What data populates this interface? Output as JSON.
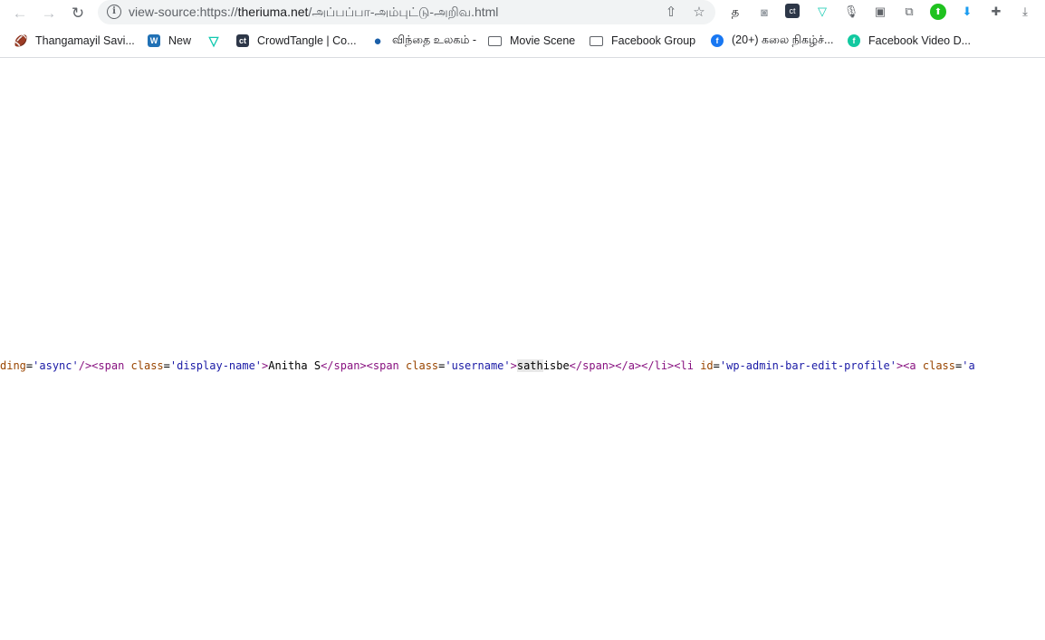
{
  "browser": {
    "url_prefix": "view-source:https://",
    "url_domain": "theriuma.net",
    "url_path": "/அப்பப்பா-அம்புட்டு-அறிவ.html"
  },
  "extensions": [
    {
      "name": "tamil-extension-icon",
      "glyph": "த",
      "color": "#202124"
    },
    {
      "name": "screenshot-extension-icon",
      "glyph": "◙",
      "color": "#9aa0a6"
    },
    {
      "name": "crowdtangle-extension-icon",
      "glyph": "ct",
      "color": "#2d3748"
    },
    {
      "name": "vidiq-extension-icon",
      "glyph": "▽",
      "color": "#12c9b0"
    },
    {
      "name": "microphone-extension-icon",
      "glyph": "🎙",
      "color": "#5f6368"
    },
    {
      "name": "capture-extension-icon",
      "glyph": "▣",
      "color": "#5f6368"
    },
    {
      "name": "copy-extension-icon",
      "glyph": "⧉",
      "color": "#5f6368"
    },
    {
      "name": "green-extension-icon",
      "glyph": "⬆",
      "color": "#1fc21f"
    },
    {
      "name": "download-arrow-extension-icon",
      "glyph": "⬇",
      "color": "#1a9cf0"
    },
    {
      "name": "puzzle-extensions-icon",
      "glyph": "✚",
      "color": "#5f6368"
    },
    {
      "name": "downloads-icon",
      "glyph": "⤓",
      "color": "#5f6368"
    }
  ],
  "bookmarks": [
    {
      "label": "Thangamayil Savi...",
      "icon": "🏈",
      "icon_color": "#b5541a"
    },
    {
      "label": "New",
      "icon": "W",
      "icon_color": "#2171b5"
    },
    {
      "label": "",
      "icon": "▽",
      "icon_color": "#12c9b0"
    },
    {
      "label": "CrowdTangle | Co...",
      "icon": "ct",
      "icon_color": "#2d3748"
    },
    {
      "label": "விந்தை உலகம் -",
      "icon": "●",
      "icon_color": "#1a5fa8"
    },
    {
      "label": "Movie Scene",
      "icon": "folder",
      "icon_color": "#5f6368"
    },
    {
      "label": "Facebook Group",
      "icon": "folder",
      "icon_color": "#5f6368"
    },
    {
      "label": "(20+) கலை நிகழ்ச்...",
      "icon": "f",
      "icon_color": "#1877f2"
    },
    {
      "label": "Facebook Video D...",
      "icon": "f",
      "icon_color": "#12c9a0"
    }
  ],
  "source": {
    "seg1_attr": "ding",
    "seg1_eq": "=",
    "seg1_val": "'async'",
    "seg2_tag": "/><span",
    "seg2_attr": "class",
    "seg2_eq": "=",
    "seg2_val": "'display-name'",
    "seg2_close": ">",
    "seg3_text": "Anitha S",
    "seg4_tag": "</span><span",
    "seg4_attr": "class",
    "seg4_eq": "=",
    "seg4_val": "'username'",
    "seg4_close": ">",
    "seg5_highlight": "sath",
    "seg5_text": "isbe",
    "seg6_tag": "</span></a></li><li",
    "seg6_attr": "id",
    "seg6_eq": "=",
    "seg6_val": "'wp-admin-bar-edit-profile'",
    "seg6_close": "><a",
    "seg7_attr": "class",
    "seg7_eq": "=",
    "seg7_val": "'a"
  }
}
